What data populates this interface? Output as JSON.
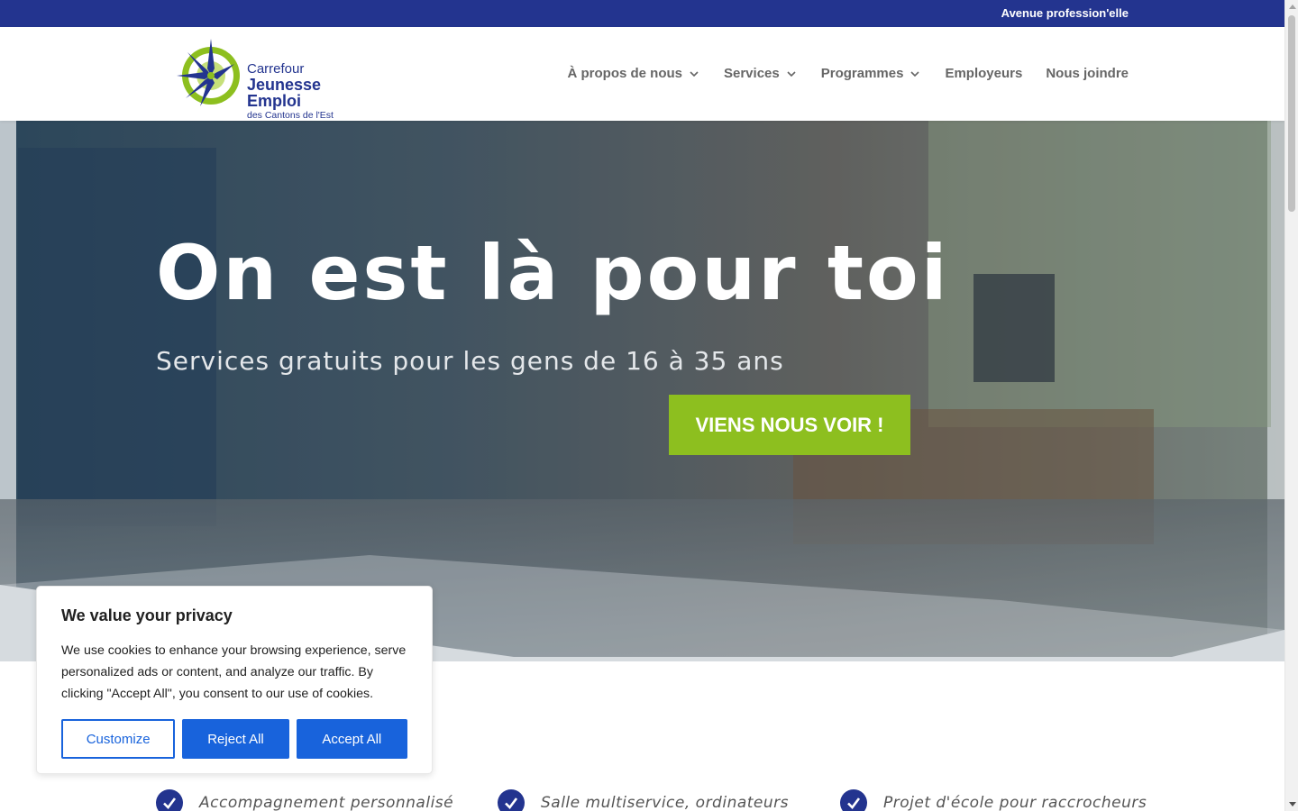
{
  "topbar": {
    "link": "Avenue profession'elle"
  },
  "logo": {
    "line1": "Carrefour",
    "line2": "Jeunesse Emploi",
    "line3": "des Cantons de l'Est"
  },
  "nav": {
    "items": [
      {
        "label": "À propos de nous",
        "has_dropdown": true
      },
      {
        "label": "Services",
        "has_dropdown": true
      },
      {
        "label": "Programmes",
        "has_dropdown": true
      },
      {
        "label": "Employeurs",
        "has_dropdown": false
      },
      {
        "label": "Nous joindre",
        "has_dropdown": false
      }
    ]
  },
  "hero": {
    "title": "On est là pour toi",
    "subtitle": "Services gratuits pour les gens de 16 à 35 ans",
    "cta": "VIENS NOUS VOIR !"
  },
  "features": [
    {
      "text": "Accompagnement personnalisé",
      "icon": "check-icon"
    },
    {
      "text": "Salle multiservice, ordinateurs",
      "icon": "check-icon"
    },
    {
      "text": "Projet d'école pour raccrocheurs",
      "icon": "check-icon"
    }
  ],
  "cookie": {
    "title": "We value your privacy",
    "body": "We use cookies to enhance your browsing experience, serve personalized ads or content, and analyze our traffic. By clicking \"Accept All\", you consent to our use of cookies.",
    "customize": "Customize",
    "reject": "Reject All",
    "accept": "Accept All"
  },
  "colors": {
    "brand_blue": "#23348f",
    "cta_green": "#8dbf1f",
    "cookie_blue": "#1863dc"
  }
}
